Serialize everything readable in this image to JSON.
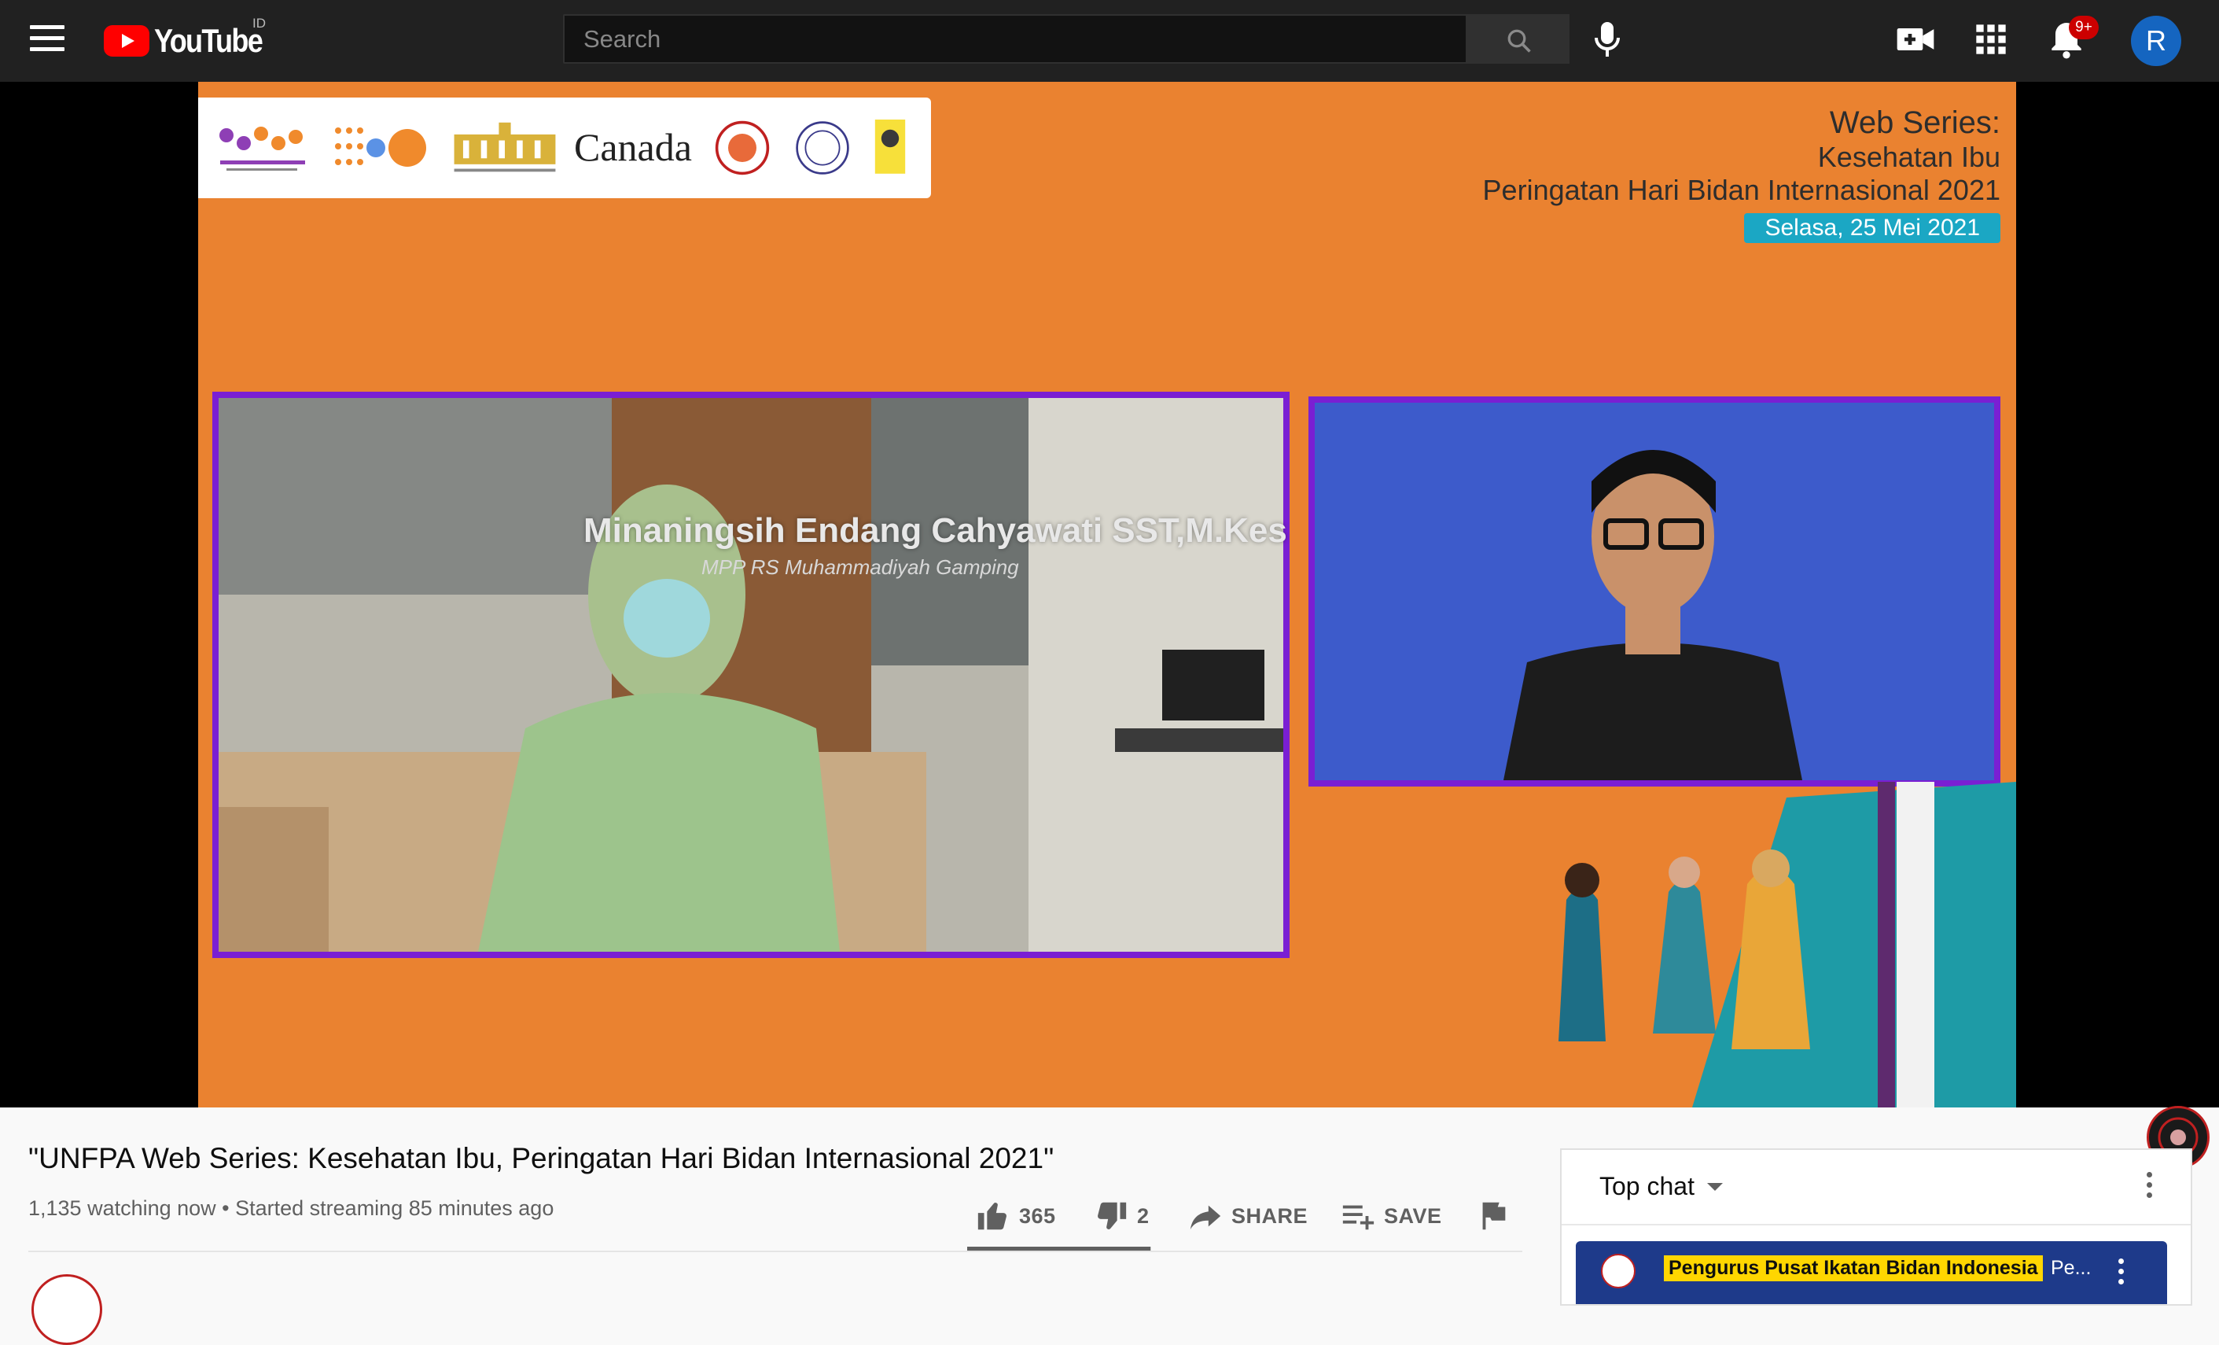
{
  "masthead": {
    "logo_text": "YouTube",
    "country_code": "ID",
    "search_placeholder": "Search",
    "notification_badge": "9+",
    "avatar_initial": "R"
  },
  "video_frame": {
    "sponsor_canada": "Canada",
    "series_title": "Web Series:",
    "series_topic": "Kesehatan Ibu",
    "series_event": "Peringatan Hari Bidan Internasional 2021",
    "series_date": "Selasa, 25 Mei 2021",
    "speaker_name": "Minaningsih Endang Cahyawati SST,M.Kes",
    "speaker_role": "MPP RS Muhammadiyah Gamping"
  },
  "video_info": {
    "title": "\"UNFPA Web Series: Kesehatan Ibu, Peringatan Hari Bidan Internasional 2021\"",
    "meta": "1,135 watching now • Started streaming 85 minutes ago",
    "likes": "365",
    "dislikes": "2",
    "like_ratio": 0.995,
    "share_label": "SHARE",
    "save_label": "SAVE"
  },
  "chat": {
    "mode_label": "Top chat",
    "pinned_author": "Pengurus Pusat Ikatan Bidan Indonesia",
    "pinned_message": "Pe..."
  },
  "colors": {
    "brand_red": "#ff0000",
    "video_orange": "#ea8230",
    "frame_purple": "#7a1fd3",
    "date_teal": "#1ba7c4",
    "avatar_blue": "#1565c0"
  }
}
